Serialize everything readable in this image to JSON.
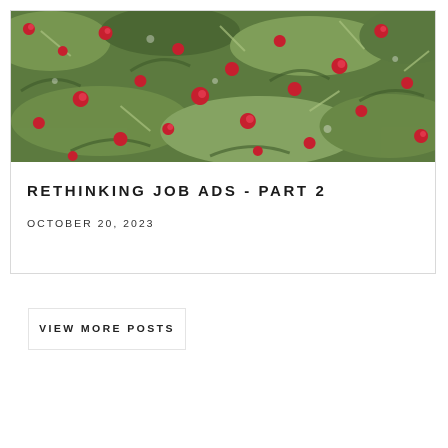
{
  "post": {
    "title": "RETHINKING JOB ADS - PART 2",
    "date": "OCTOBER 20, 2023",
    "image_subject": "red-flowers-among-green-leaves"
  },
  "actions": {
    "view_more_label": "VIEW MORE POSTS"
  },
  "colors": {
    "card_border": "#d9d9d9",
    "title_text": "#1b1b1b",
    "button_border": "#e4e4e4",
    "foliage": "#6b8845",
    "flower": "#c61f2e"
  }
}
